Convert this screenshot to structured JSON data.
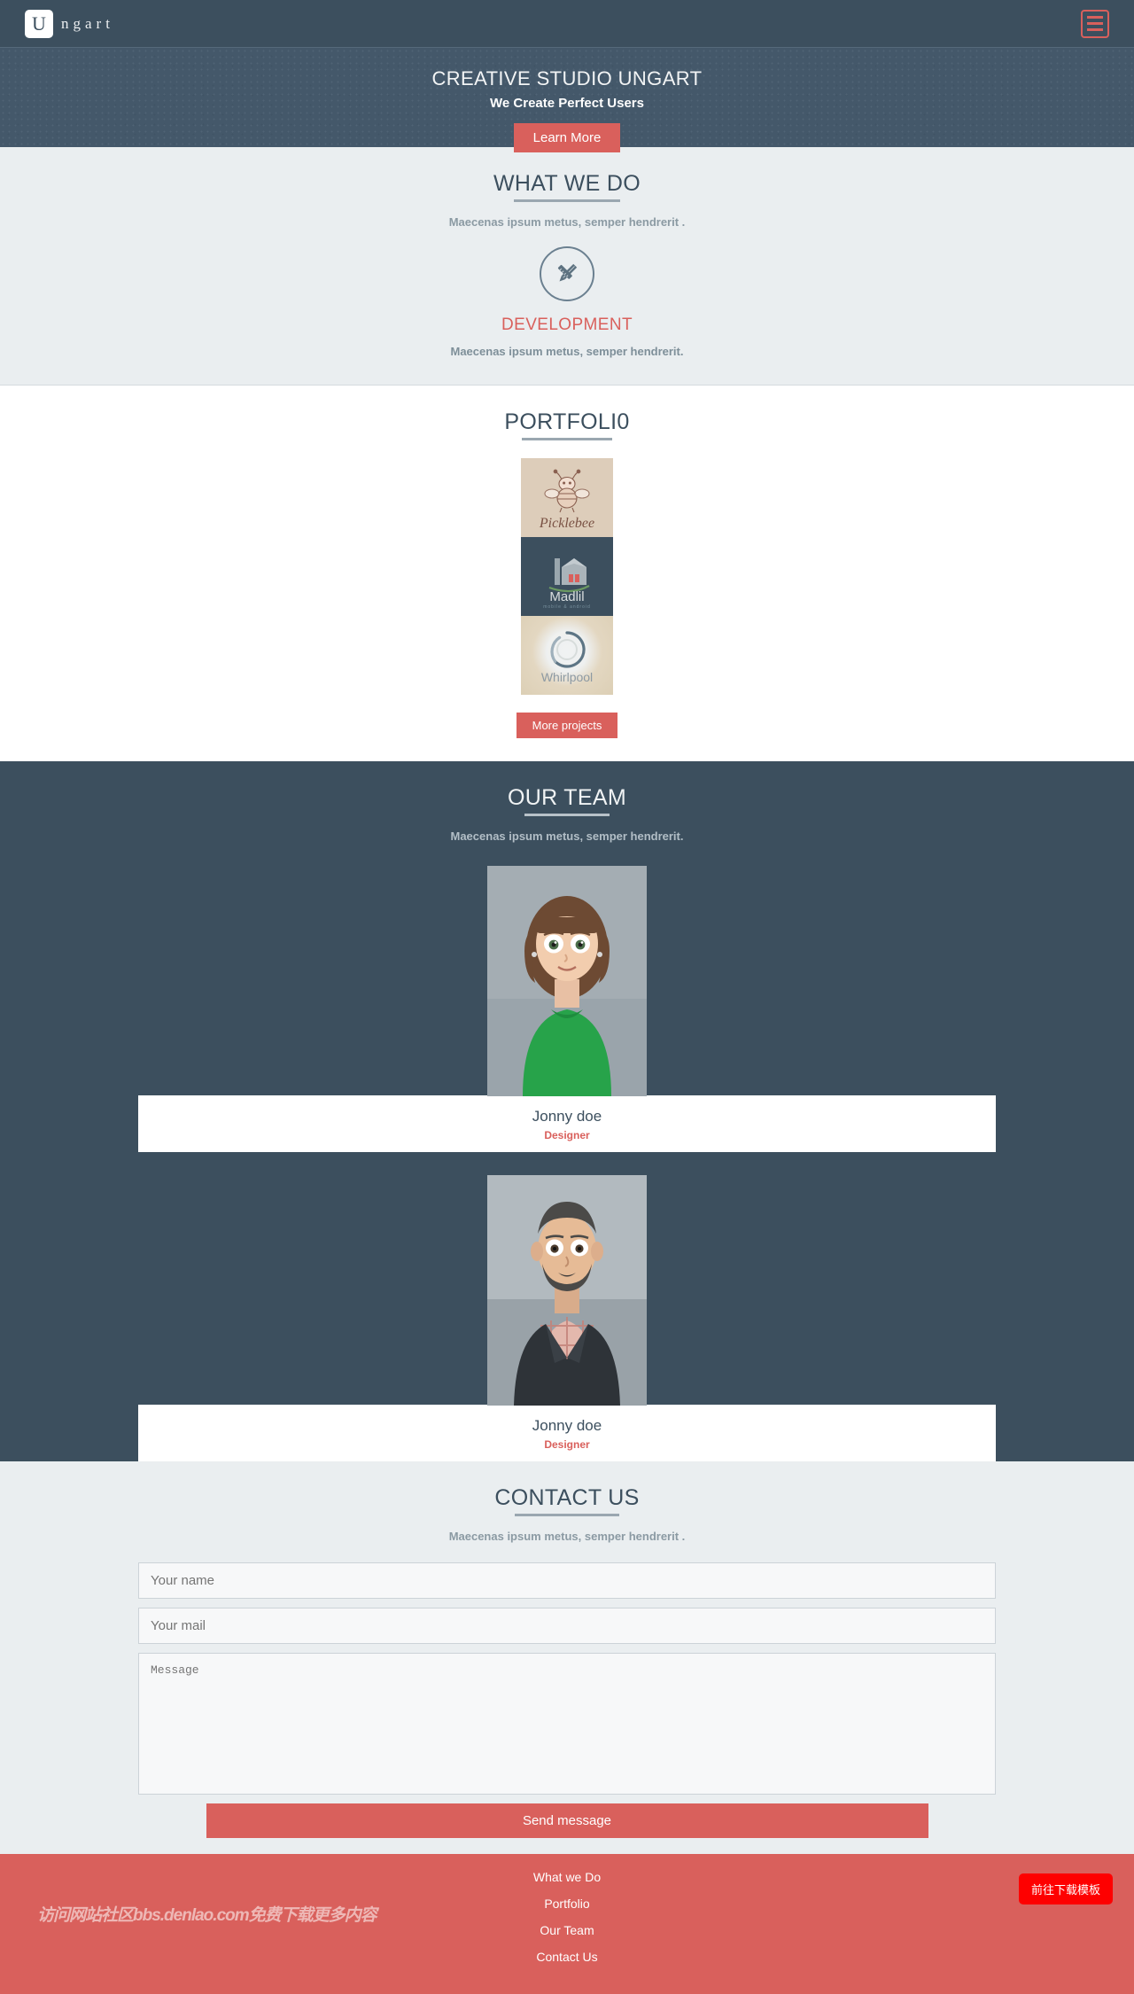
{
  "navbar": {
    "logo_letter": "U",
    "logo_text": "ngart",
    "menu_icon": "hamburger-icon"
  },
  "hero": {
    "title": "CREATIVE STUDIO UNGART",
    "subtitle": "We Create Perfect Users",
    "cta_label": "Learn More"
  },
  "what_we_do": {
    "title": "WHAT WE DO",
    "subtitle": "Maecenas ipsum metus, semper hendrerit .",
    "services": [
      {
        "icon": "pencil-ruler-icon",
        "name": "DEVELOPMENT",
        "desc": "Maecenas ipsum metus, semper hendrerit."
      }
    ]
  },
  "portfolio": {
    "title": "PORTFOLI0",
    "items": [
      {
        "name": "Picklebee",
        "sub": ""
      },
      {
        "name": "Madlil",
        "sub": "mobile & android"
      },
      {
        "name": "Whirlpool",
        "sub": ""
      }
    ],
    "more_label": "More projects"
  },
  "team": {
    "title": "OUR TEAM",
    "subtitle": "Maecenas ipsum metus, semper hendrerit.",
    "members": [
      {
        "name": "Jonny doe",
        "role": "Designer",
        "photo": "girl-portrait"
      },
      {
        "name": "Jonny doe",
        "role": "Designer",
        "photo": "man-portrait"
      }
    ]
  },
  "contact": {
    "title": "CONTACT US",
    "subtitle": "Maecenas ipsum metus, semper hendrerit .",
    "name_placeholder": "Your name",
    "name_value": "",
    "mail_placeholder": "Your mail",
    "mail_value": "",
    "message_placeholder": "Message",
    "message_value": "",
    "send_label": "Send message"
  },
  "footer": {
    "links": [
      "What we Do",
      "Portfolio",
      "Our Team",
      "Contact Us"
    ],
    "watermark": "访问网站社区bbs.denlao.com免费下载更多内容",
    "download_label": "前往下载模板"
  },
  "colors": {
    "accent_red": "#d9605c",
    "dark_slate": "#3c4f5e",
    "hero_slate": "#44586a",
    "light_bg": "#eaeef0",
    "download_red": "#fe0000"
  }
}
